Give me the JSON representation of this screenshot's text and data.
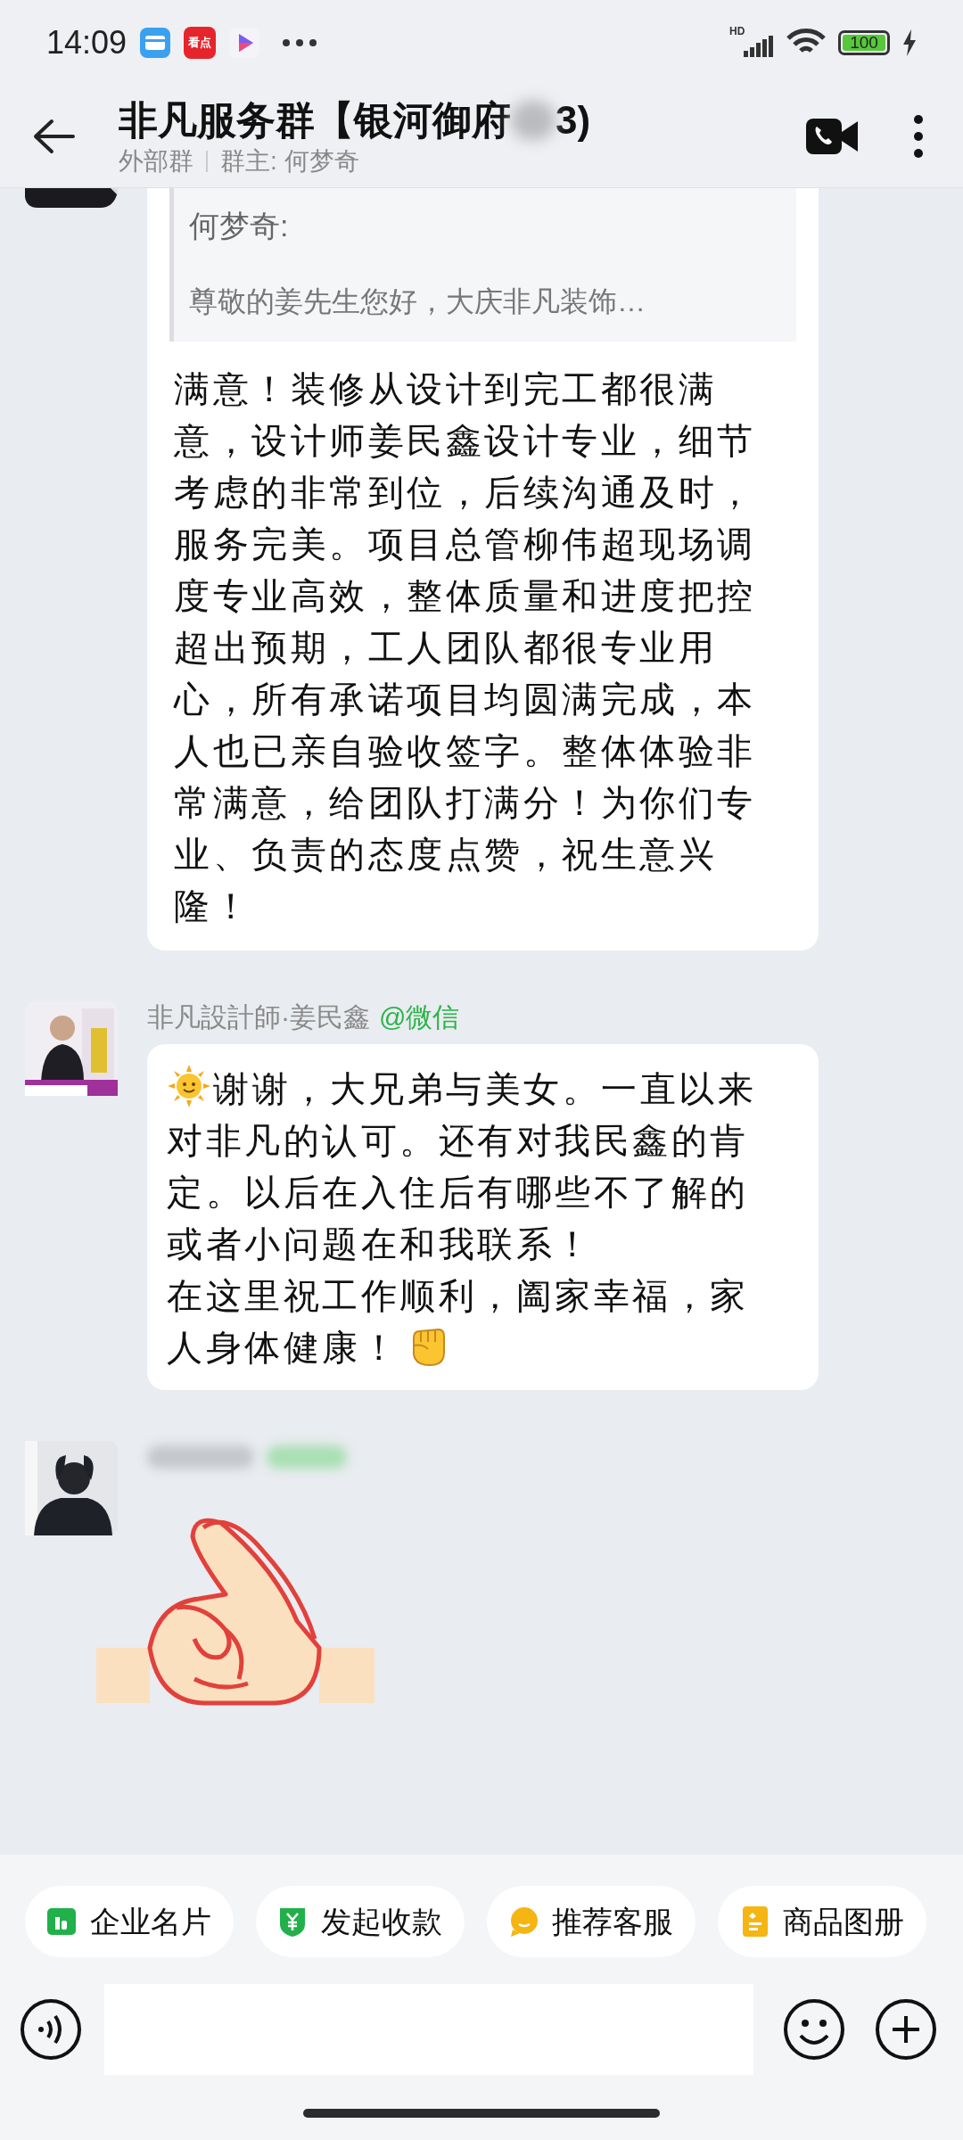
{
  "status_bar": {
    "time": "14:09",
    "app_icon_text": "看点",
    "network": "HD",
    "battery": "100"
  },
  "header": {
    "title_start": "非凡服务群【银河御府",
    "title_end": "3)",
    "group_type": "外部群",
    "owner": "群主: 何梦奇"
  },
  "messages": [
    {
      "kind": "quote_reply",
      "quote_author": "何梦奇:",
      "quote_text": "尊敬的姜先生您好，大庆非凡装饰…",
      "lines": [
        "满意！装修从设计到完工都很满",
        "意，设计师姜民鑫设计专业，细节",
        "考虑的非常到位，后续沟通及时，",
        "服务完美。项目总管柳伟超现场调",
        "度专业高效，整体质量和进度把控",
        "超出预期，工人团队都很专业用",
        "心，所有承诺项目均圆满完成，本",
        "人也已亲自验收签字。整体体验非",
        "常满意，给团队打满分！为你们专",
        "业、负责的态度点赞，祝生意兴",
        "隆！"
      ]
    },
    {
      "kind": "text",
      "sender": "非凡設計師·姜民鑫",
      "source": "@微信",
      "lines": [
        "谢谢，大兄弟与美女。一直以来",
        "对非凡的认可。还有对我民鑫的肯",
        "定。以后在入住后有哪些不了解的",
        "或者小问题在和我联系！",
        "在这里祝工作顺利，阖家幸福，家",
        "人身体健康！"
      ]
    },
    {
      "kind": "sticker"
    }
  ],
  "quick_actions": [
    {
      "label": "企业名片",
      "color": "#22b04b"
    },
    {
      "label": "发起收款",
      "color": "#22b04b"
    },
    {
      "label": "推荐客服",
      "color": "#f5b512"
    },
    {
      "label": "商品图册",
      "color": "#f5b512"
    }
  ]
}
